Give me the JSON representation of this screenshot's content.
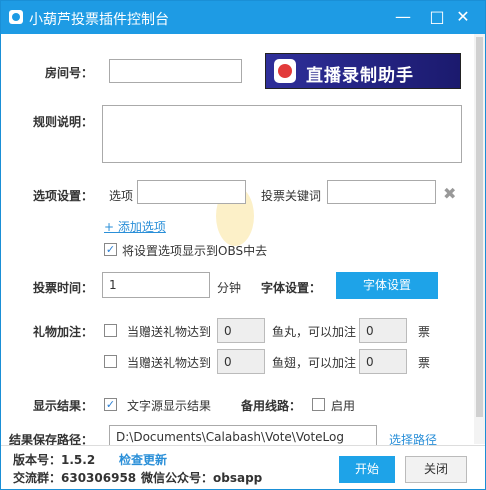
{
  "window": {
    "title": "小葫芦投票插件控制台",
    "controls": {
      "minimize": "—",
      "maximize": "□",
      "close": "✕"
    }
  },
  "room": {
    "label": "房间号："
  },
  "banner": {
    "text": "直播录制助手"
  },
  "rules": {
    "label": "规则说明："
  },
  "options": {
    "label": "选项设置：",
    "option_text": "选项",
    "keyword_text": "投票关键词",
    "add_link": "+ 添加选项",
    "show_obs": "将设置选项显示到OBS中去"
  },
  "vote_time": {
    "label": "投票时间：",
    "value": "1",
    "unit": "分钟"
  },
  "font": {
    "label": "字体设置：",
    "button": "字体设置"
  },
  "gift": {
    "label": "礼物加注：",
    "rows": [
      {
        "prefix": "当赠送礼物达到",
        "amount": "0",
        "item": "鱼丸，可以加注",
        "votes": "0",
        "suffix": "票"
      },
      {
        "prefix": "当赠送礼物达到",
        "amount": "0",
        "item": "鱼翅，可以加注",
        "votes": "0",
        "suffix": "票"
      }
    ]
  },
  "display": {
    "label": "显示结果：",
    "check_text": "文字源显示结果",
    "backup_label": "备用线路：",
    "enable_text": "启用"
  },
  "save": {
    "label": "结果保存路径：",
    "path": "D:\\Documents\\Calabash\\Vote\\VoteLog",
    "choose_link": "选择路径"
  },
  "footer": {
    "version_label": "版本号：1.5.2",
    "check_update": "检查更新",
    "group": "交流群：630306958",
    "wechat": "微信公众号：obsapp",
    "start_button": "开始",
    "close_button": "关闭"
  },
  "colors": {
    "titlebar": "#1e9be4",
    "accent": "#1ea3e8",
    "link": "#2a8fd8"
  }
}
